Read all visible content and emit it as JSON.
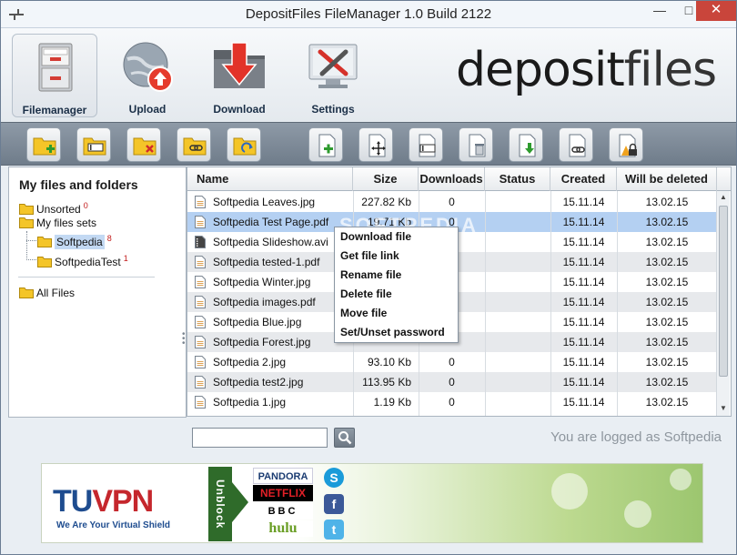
{
  "window": {
    "title": "DepositFiles FileManager 1.0 Build 2122"
  },
  "mainnav": [
    {
      "label": "Filemanager",
      "icon": "cabinet-icon",
      "active": true
    },
    {
      "label": "Upload",
      "icon": "globe-upload-icon",
      "active": false
    },
    {
      "label": "Download",
      "icon": "folder-download-icon",
      "active": false
    },
    {
      "label": "Settings",
      "icon": "settings-tools-icon",
      "active": false
    }
  ],
  "logo": {
    "part1": "deposit",
    "part2": "files"
  },
  "left_panel": {
    "title": "My files and folders",
    "items": [
      {
        "label": "Unsorted",
        "count": "0"
      },
      {
        "label": "My files sets",
        "count": ""
      },
      {
        "label": "Softpedia",
        "count": "8"
      },
      {
        "label": "SoftpediaTest",
        "count": "1"
      },
      {
        "label": "All Files",
        "count": ""
      }
    ]
  },
  "table": {
    "columns": [
      "Name",
      "Size",
      "Downloads",
      "Status",
      "Created",
      "Will be deleted"
    ],
    "rows": [
      {
        "name": "Softpedia Leaves.jpg",
        "size": "227.82 Kb",
        "downloads": "0",
        "status": "",
        "created": "15.11.14",
        "deleted": "13.02.15"
      },
      {
        "name": "Softpedia Test Page.pdf",
        "size": "19.71 Kb",
        "downloads": "0",
        "status": "",
        "created": "15.11.14",
        "deleted": "13.02.15"
      },
      {
        "name": "Softpedia Slideshow.avi",
        "size": "",
        "downloads": "",
        "status": "",
        "created": "15.11.14",
        "deleted": "13.02.15"
      },
      {
        "name": "Softpedia tested-1.pdf",
        "size": "",
        "downloads": "",
        "status": "",
        "created": "15.11.14",
        "deleted": "13.02.15"
      },
      {
        "name": "Softpedia Winter.jpg",
        "size": "",
        "downloads": "",
        "status": "",
        "created": "15.11.14",
        "deleted": "13.02.15"
      },
      {
        "name": "Softpedia images.pdf",
        "size": "",
        "downloads": "",
        "status": "",
        "created": "15.11.14",
        "deleted": "13.02.15"
      },
      {
        "name": "Softpedia Blue.jpg",
        "size": "",
        "downloads": "",
        "status": "",
        "created": "15.11.14",
        "deleted": "13.02.15"
      },
      {
        "name": "Softpedia Forest.jpg",
        "size": "",
        "downloads": "",
        "status": "",
        "created": "15.11.14",
        "deleted": "13.02.15"
      },
      {
        "name": "Softpedia 2.jpg",
        "size": "93.10 Kb",
        "downloads": "0",
        "status": "",
        "created": "15.11.14",
        "deleted": "13.02.15"
      },
      {
        "name": "Softpedia test2.jpg",
        "size": "113.95 Kb",
        "downloads": "0",
        "status": "",
        "created": "15.11.14",
        "deleted": "13.02.15"
      },
      {
        "name": "Softpedia 1.jpg",
        "size": "1.19 Kb",
        "downloads": "0",
        "status": "",
        "created": "15.11.14",
        "deleted": "13.02.15"
      }
    ]
  },
  "context_menu": [
    "Download file",
    "Get file link",
    "Rename file",
    "Delete file",
    "Move file",
    "Set/Unset password"
  ],
  "watermark": "SOFTPEDIA",
  "search": {
    "value": "",
    "placeholder": ""
  },
  "status": "You are logged as Softpedia",
  "ad": {
    "brand_a": "TU",
    "brand_b": "VPN",
    "tagline": "We Are Your Virtual Shield",
    "unblock": "Unblock",
    "services": [
      "PANDORA",
      "NETFLIX",
      "BBC",
      "hulu"
    ],
    "social": [
      "S",
      "f",
      "t"
    ]
  },
  "colors": {
    "selection": "#b4d0f2",
    "close_button": "#c9453b",
    "toolbar": "#7f8b98",
    "folder": "#f4c528"
  }
}
